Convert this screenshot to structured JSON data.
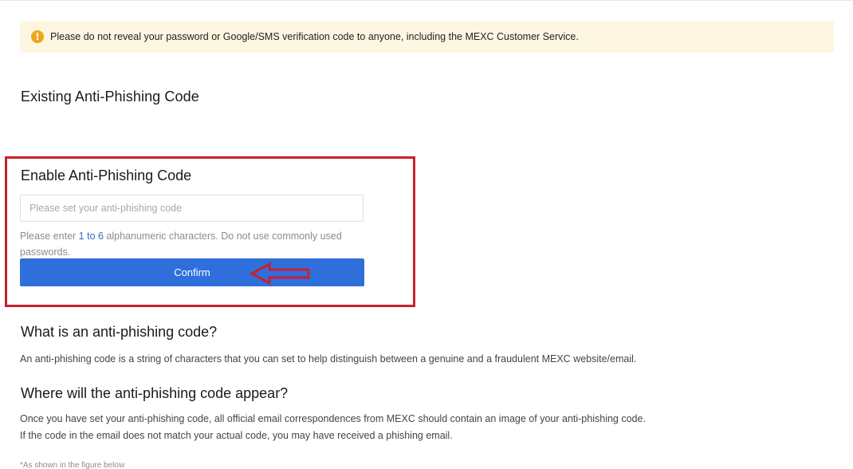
{
  "warning": {
    "icon": "exclamation-icon",
    "text": "Please do not reveal your password or Google/SMS verification code to anyone, including the MEXC Customer Service."
  },
  "existing": {
    "title": "Existing Anti-Phishing Code"
  },
  "enable": {
    "title": "Enable Anti-Phishing Code",
    "input_placeholder": "Please set your anti-phishing code",
    "input_value": "",
    "hint_prefix": "Please enter ",
    "hint_highlight": "1 to 6",
    "hint_suffix": " alphanumeric characters. Do not use commonly used passwords.",
    "confirm_label": "Confirm"
  },
  "what": {
    "title": "What is an anti-phishing code?",
    "body": "An anti-phishing code is a string of characters that you can set to help distinguish between a genuine and a fraudulent MEXC website/email."
  },
  "where": {
    "title": "Where will the anti-phishing code appear?",
    "body_line1": "Once you have set your anti-phishing code, all official email correspondences from MEXC should contain an image of your anti-phishing code.",
    "body_line2": "If the code in the email does not match your actual code, you may have received a phishing email."
  },
  "footnote": "*As shown in the figure below",
  "colors": {
    "accent": "#2f6fdc",
    "warning_bg": "#fdf6e1",
    "warning_icon": "#f0a51c",
    "annotation": "#c8202e"
  }
}
